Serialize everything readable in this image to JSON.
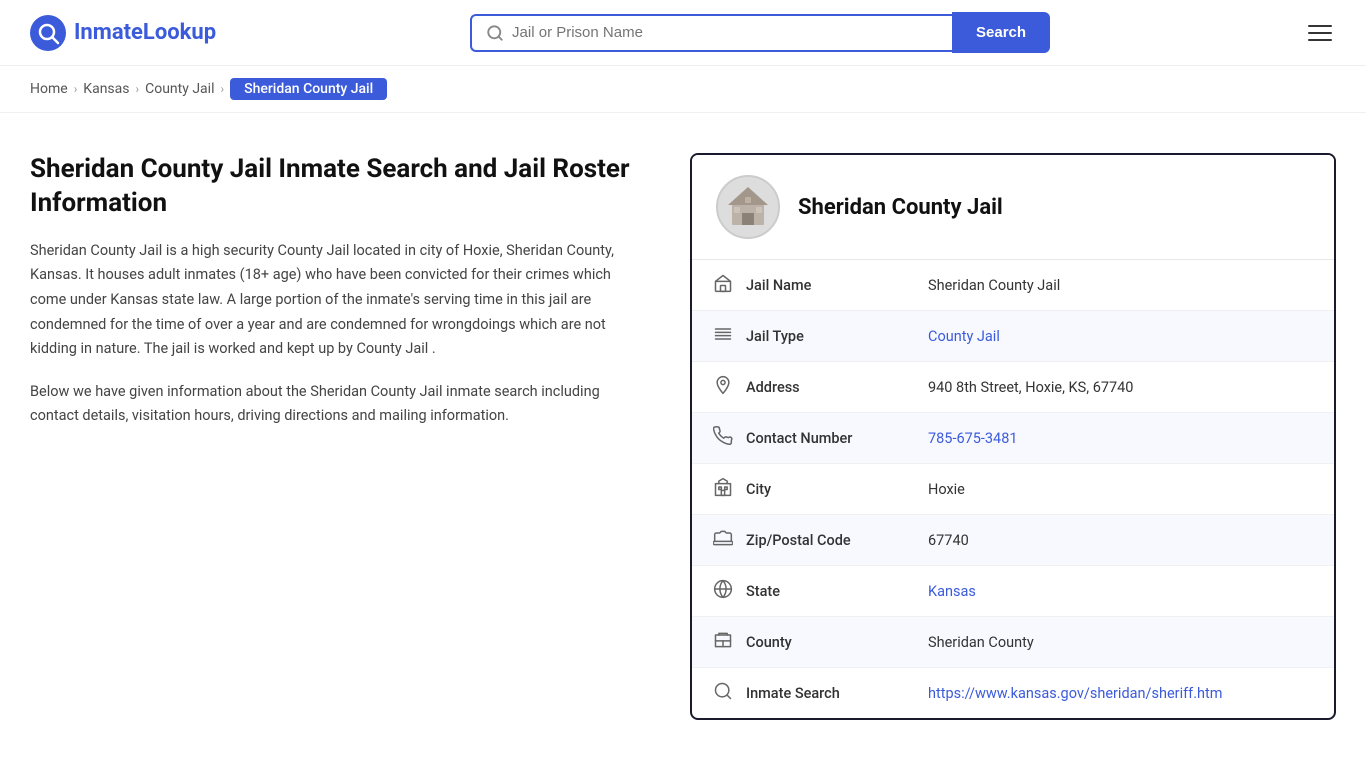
{
  "header": {
    "logo_brand": "InmateLookup",
    "logo_brand_colored": "Inmate",
    "logo_brand_plain": "Lookup",
    "search_placeholder": "Jail or Prison Name",
    "search_button_label": "Search"
  },
  "breadcrumb": {
    "home": "Home",
    "state": "Kansas",
    "type": "County Jail",
    "current": "Sheridan County Jail"
  },
  "left": {
    "title": "Sheridan County Jail Inmate Search and Jail Roster Information",
    "description1": "Sheridan County Jail is a high security County Jail located in city of Hoxie, Sheridan County, Kansas. It houses adult inmates (18+ age) who have been convicted for their crimes which come under Kansas state law. A large portion of the inmate's serving time in this jail are condemned for the time of over a year and are condemned for wrongdoings which are not kidding in nature. The jail is worked and kept up by County Jail .",
    "description2": "Below we have given information about the Sheridan County Jail inmate search including contact details, visitation hours, driving directions and mailing information."
  },
  "card": {
    "jail_name_header": "Sheridan County Jail",
    "rows": [
      {
        "icon": "jail-icon",
        "icon_char": "🏛",
        "label": "Jail Name",
        "value": "Sheridan County Jail",
        "link": false
      },
      {
        "icon": "type-icon",
        "icon_char": "≡",
        "label": "Jail Type",
        "value": "County Jail",
        "link": true,
        "link_url": "#"
      },
      {
        "icon": "address-icon",
        "icon_char": "📍",
        "label": "Address",
        "value": "940 8th Street, Hoxie, KS, 67740",
        "link": false
      },
      {
        "icon": "phone-icon",
        "icon_char": "📞",
        "label": "Contact Number",
        "value": "785-675-3481",
        "link": true,
        "link_url": "tel:785-675-3481"
      },
      {
        "icon": "city-icon",
        "icon_char": "🏙",
        "label": "City",
        "value": "Hoxie",
        "link": false
      },
      {
        "icon": "zip-icon",
        "icon_char": "✉",
        "label": "Zip/Postal Code",
        "value": "67740",
        "link": false
      },
      {
        "icon": "state-icon",
        "icon_char": "🌐",
        "label": "State",
        "value": "Kansas",
        "link": true,
        "link_url": "#"
      },
      {
        "icon": "county-icon",
        "icon_char": "🗺",
        "label": "County",
        "value": "Sheridan County",
        "link": false
      },
      {
        "icon": "search-icon",
        "icon_char": "🔍",
        "label": "Inmate Search",
        "value": "https://www.kansas.gov/sheridan/sheriff.htm",
        "link": true,
        "link_url": "https://www.kansas.gov/sheridan/sheriff.htm"
      }
    ]
  }
}
